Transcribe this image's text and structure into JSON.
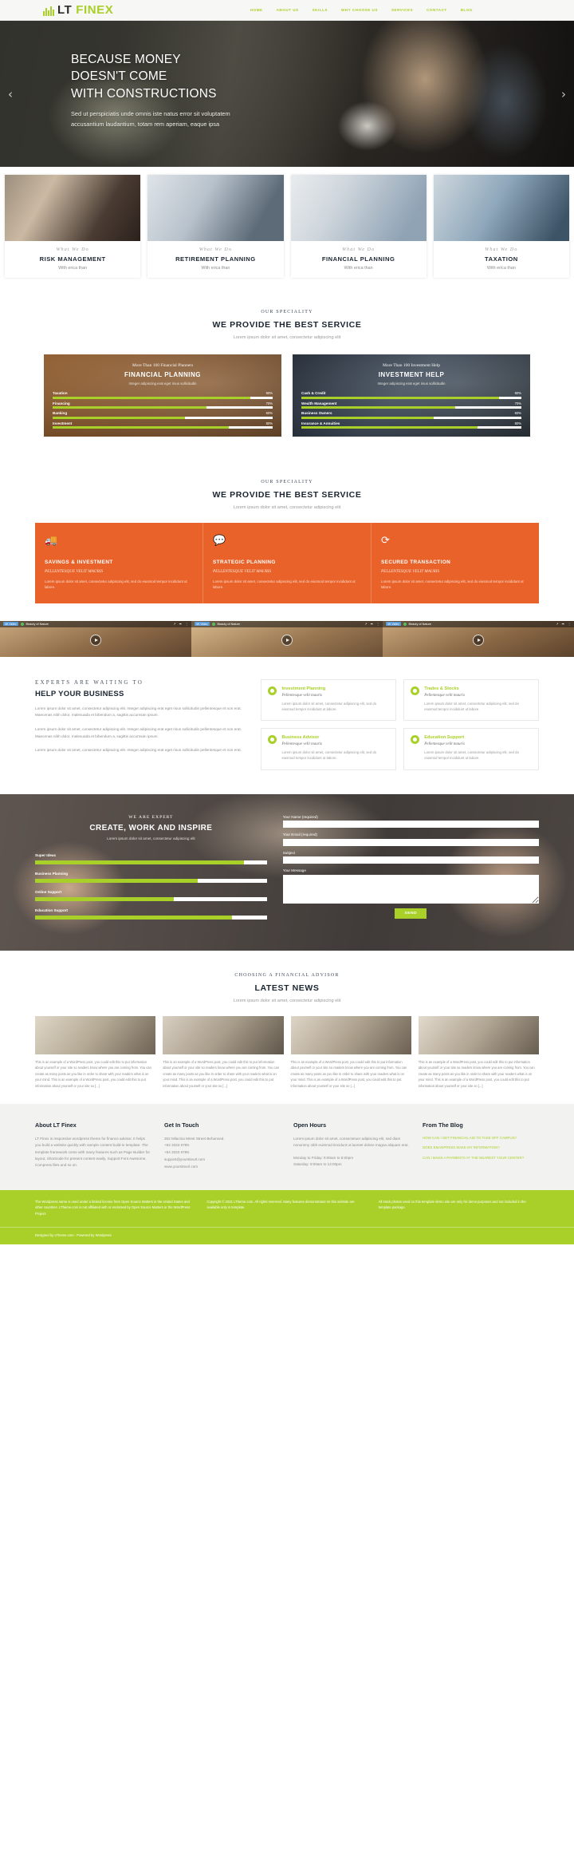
{
  "header": {
    "logo_lt": "LT",
    "logo_finex": "FINEX",
    "nav": [
      {
        "label": "HOME"
      },
      {
        "label": "ABOUT US"
      },
      {
        "label": "SKILLS"
      },
      {
        "label": "WHY CHOOSE US"
      },
      {
        "label": "SERVICES"
      },
      {
        "label": "CONTACT"
      },
      {
        "label": "BLOG"
      }
    ]
  },
  "hero": {
    "title_line1": "BECAUSE MONEY",
    "title_line2": "DOESN'T COME",
    "title_line3": "WITH CONSTRUCTIONS",
    "paragraph": "Sed ut perspiciatis unde omnis iste natus error sit voluptatem accusantium laudantium, totam rem aperiam, eaque ipsa",
    "prev_icon": "‹",
    "next_icon": "›"
  },
  "cards": [
    {
      "kicker": "What We Do",
      "title": "RISK MANAGEMENT",
      "sub": "With erica than"
    },
    {
      "kicker": "What We Do",
      "title": "RETIREMENT PLANNING",
      "sub": "With erica than"
    },
    {
      "kicker": "What We Do",
      "title": "FINANCIAL PLANNING",
      "sub": "With erica than"
    },
    {
      "kicker": "What We Do",
      "title": "TAXATION",
      "sub": "With erica than"
    }
  ],
  "speciality1": {
    "kicker": "OUR SPECIALITY",
    "title": "WE PROVIDE THE BEST SERVICE",
    "sub": "Lorem ipsum dolor sit amet, consectetur adipiscing elit"
  },
  "panels": [
    {
      "kicker": "More Than 100 Financial Planners",
      "title": "FINANCIAL PLANNING",
      "desc": "Integer adipiscing erat eget risus sollicitudin",
      "bars": [
        {
          "label": "Taxation",
          "pct": "90%",
          "value": 90
        },
        {
          "label": "Financing",
          "pct": "70%",
          "value": 70
        },
        {
          "label": "Banking",
          "pct": "60%",
          "value": 60
        },
        {
          "label": "Investment",
          "pct": "80%",
          "value": 80
        }
      ]
    },
    {
      "kicker": "More Than 100 Investment Help",
      "title": "INVESTMENT HELP",
      "desc": "Integer adipiscing erat eget risus sollicitudin",
      "bars": [
        {
          "label": "Cash & Credit",
          "pct": "90%",
          "value": 90
        },
        {
          "label": "Wealth Management",
          "pct": "70%",
          "value": 70
        },
        {
          "label": "Business Owners",
          "pct": "60%",
          "value": 60
        },
        {
          "label": "Insurance & Annuities",
          "pct": "80%",
          "value": 80
        }
      ]
    }
  ],
  "speciality2": {
    "kicker": "OUR SPECIALITY",
    "title": "WE PROVIDE THE BEST SERVICE",
    "sub": "Lorem ipsum dolor sit amet, consectetur adipiscing elit"
  },
  "features": [
    {
      "icon": "🚚",
      "title": "SAVINGS & INVESTMENT",
      "sub": "PELLENTESQUE VELIT MAURIS",
      "text": "Lorem ipsum dolor sit amet, consectetur adipiscing elit, sed do eiusmod tempor incididunt ut labore."
    },
    {
      "icon": "💬",
      "title": "STRATEGIC PLANNING",
      "sub": "PELLENTESQUE VELIT MAURIS",
      "text": "Lorem ipsum dolor sit amet, consectetur adipiscing elit, sed do eiusmod tempor incididunt ut labore."
    },
    {
      "icon": "⟳",
      "title": "SECURED TRANSACTION",
      "sub": "PELLENTESQUE VELIT MAURIS",
      "text": "Lorem ipsum dolor sit amet, consectetur adipiscing elit, sed do eiusmod tempor incididunt ut labore."
    }
  ],
  "videos": [
    {
      "tag": "4K Video",
      "title": "Beauty of Nature"
    },
    {
      "tag": "4K Video",
      "title": "Beauty of Nature"
    },
    {
      "tag": "4K Video",
      "title": "Beauty of Nature"
    }
  ],
  "experts": {
    "kicker": "EXPERTS ARE WAITING TO",
    "title": "HELP YOUR BUSINESS",
    "paragraphs": [
      "Lorem ipsum dolor sit amet, consectetur adipiscing elit. Integer adipiscing erat eget risus sollicitudin pellentesque et non erat. Maecenas nibh dolor, malesuada et bibendum a, sagittis accumsan ipsum.",
      "Lorem ipsum dolor sit amet, consectetur adipiscing elit. Integer adipiscing erat eget risus sollicitudin pellentesque et non erat. Maecenas nibh dolor, malesuada et bibendum a, sagittis accumsan ipsum.",
      "Lorem ipsum dolor sit amet, consectetur adipiscing elit. Integer adipiscing erat eget risus sollicitudin pellentesque et non erat."
    ],
    "cards": [
      {
        "title": "Investment Planning",
        "sub": "Pellentesque velit mauris",
        "text": "Lorem ipsum dolor sit amet, consectetur adipiscing elit, sed do eiusmod tempor incididunt ut labore."
      },
      {
        "title": "Trades & Stocks",
        "sub": "Pellentesque velit mauris",
        "text": "Lorem ipsum dolor sit amet, consectetur adipiscing elit, sed do eiusmod tempor incididunt ut labore."
      },
      {
        "title": "Business Advisor",
        "sub": "Pellentesque velit mauris",
        "text": "Lorem ipsum dolor sit amet, consectetur adipiscing elit, sed do eiusmod tempor incididunt ut labore."
      },
      {
        "title": "Education Support",
        "sub": "Pellentesque velit mauris",
        "text": "Lorem ipsum dolor sit amet, consectetur adipiscing elit, sed do eiusmod tempor incididunt ut labore."
      }
    ]
  },
  "contact": {
    "kicker": "WE ARE EXPERT",
    "title": "CREATE, WORK AND INSPIRE",
    "sub": "Lorem ipsum dolor sit amet, consectetur adipiscing elit",
    "bars": [
      {
        "label": "Super Ideas",
        "pct": "90%",
        "value": 90
      },
      {
        "label": "Business Planning",
        "pct": "70%",
        "value": 70
      },
      {
        "label": "Online Support",
        "pct": "60%",
        "value": 60
      },
      {
        "label": "Education Support",
        "pct": "85%",
        "value": 85
      }
    ],
    "fields": [
      {
        "label": "Your Name (required)",
        "value": ""
      },
      {
        "label": "Your Email (required)",
        "value": ""
      },
      {
        "label": "Subject",
        "value": ""
      },
      {
        "label": "Your Message",
        "value": ""
      }
    ],
    "send_label": "SEND"
  },
  "news": {
    "kicker": "CHOOSING A FINANCIAL ADVISOR",
    "title": "LATEST NEWS",
    "sub": "Lorem ipsum dolor sit amet, consectetur adipiscing elit",
    "posts": [
      {
        "text": "This is an example of a WordPress post, you could edit this to put information about yourself or your site so readers know where you are coming from. You can create as many posts as you like in order to share with your readers what is on your mind. This is an example of a WordPress post, you could edit this to put information about yourself or your site so [...]"
      },
      {
        "text": "This is an example of a WordPress post, you could edit this to put information about yourself or your site so readers know where you are coming from. You can create as many posts as you like in order to share with your readers what is on your mind. This is an example of a WordPress post, you could edit this to put information about yourself or your site so [...]"
      },
      {
        "text": "This is an example of a WordPress post, you could edit this to put information about yourself or your site so readers know where you are coming from. You can create as many posts as you like in order to share with your readers what is on your mind. This is an example of a WordPress post, you could edit this to put information about yourself or your site so [...]"
      },
      {
        "text": "This is an example of a WordPress post, you could edit this to put information about yourself or your site so readers know where you are coming from. You can create as many posts as you like in order to share with your readers what is on your mind. This is an example of a WordPress post, you could edit this to put information about yourself or your site so [...]"
      }
    ]
  },
  "footer": {
    "about": {
      "title": "About LT Finex",
      "text": "LT Finex is responsive wordpress theme for finance advisor. It helps you build a website quickly with sample content build-in template. The template framework come with many features such as Page Builder for layout, Shortcode for present content easily, Support Font Awesome, Compress files and so on."
    },
    "touch": {
      "title": "Get In Touch",
      "lines": [
        "262 Milacina Mrest Street Behanned.",
        "+84 3333 6789.",
        "+84 3333 6789.",
        "support@yoursiteurl.com",
        "www.yoursiteurl.com"
      ]
    },
    "hours": {
      "title": "Open Hours",
      "text": "Lorem ipsum dolor sit amet, consectetuer adipiscing elit, sed diam nonummy nibh euismod tincidunt ut laoreet dolore magna aliquam erat.",
      "lines": [
        "Monday to Friday: 9:00am to 5:00pm",
        "Saturday: 9:00am to 12:00pm"
      ]
    },
    "blog": {
      "title": "From The Blog",
      "links": [
        "HOW CAN I GET FINANCIAL AID TO TAKE OFF CAMPUS?",
        "DOES EMANPRESS MAKE MY INFORMATION?",
        "CAN I MAKE A PAYMENTS AT THE NEAREST YOUR CENTER?"
      ]
    },
    "copy_left": "The Wordpress name is used under a limited license from Open Source Matters in the United States and other countries. LTheme.com is not affiliated with or endorsed by Open Source Matters or the WordPress Project.",
    "copy_right": "Copyright © 2021 LTheme.com. All rights reserved. Many features demonstrated on this website are available only in template.",
    "copy_right2": "All stock photos used on this template demo site are only for demo purposes and not included in the template package.",
    "bottom": "Designed by LTheme.com - Powered by Wordpress"
  },
  "colors": {
    "accent": "#a9d028",
    "orange": "#e8622a",
    "dark": "#1b2531"
  }
}
